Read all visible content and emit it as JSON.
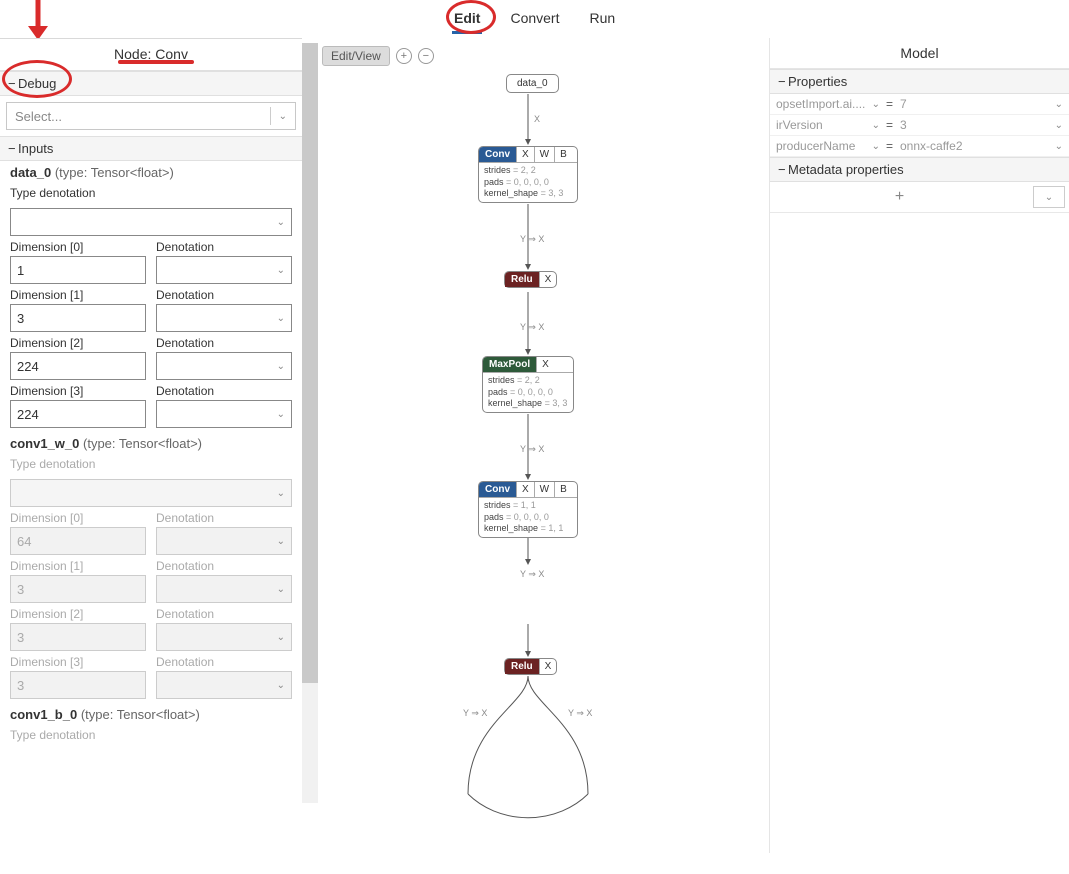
{
  "tabs": {
    "edit": "Edit",
    "convert": "Convert",
    "run": "Run"
  },
  "left": {
    "header": "Node: Conv",
    "debug_section": "Debug",
    "select_placeholder": "Select...",
    "inputs_section": "Inputs",
    "data0": {
      "name": "data_0",
      "type": "(type: Tensor<float>)"
    },
    "type_denotation_label": "Type denotation",
    "dim_label_prefix": "Dimension",
    "denotation_label": "Denotation",
    "data0_dims": [
      "1",
      "3",
      "224",
      "224"
    ],
    "conv1w": {
      "name": "conv1_w_0",
      "type": "(type: Tensor<float>)"
    },
    "conv1w_dims": [
      "64",
      "3",
      "3",
      "3"
    ],
    "conv1b": {
      "name": "conv1_b_0",
      "type": "(type: Tensor<float>)"
    }
  },
  "center": {
    "editview": "Edit/View",
    "input_node": "data_0",
    "edge_x": "X",
    "edge_yx": "Y ⇒ X",
    "conv": {
      "op": "Conv",
      "ports": [
        "X",
        "W",
        "B"
      ],
      "strides": "strides",
      "strides_v": "= 2, 2",
      "pads": "pads",
      "pads_v": "= 0, 0, 0, 0",
      "ks": "kernel_shape",
      "ks_v": "= 3, 3"
    },
    "relu": {
      "op": "Relu",
      "ports": [
        "X"
      ]
    },
    "maxpool": {
      "op": "MaxPool",
      "ports": [
        "X"
      ],
      "strides": "strides",
      "strides_v": "= 2, 2",
      "pads": "pads",
      "pads_v": "= 0, 0, 0, 0",
      "ks": "kernel_shape",
      "ks_v": "= 3, 3"
    },
    "conv2": {
      "op": "Conv",
      "ports": [
        "X",
        "W",
        "B"
      ],
      "strides": "strides",
      "strides_v": "= 1, 1",
      "pads": "pads",
      "pads_v": "= 0, 0, 0, 0",
      "ks": "kernel_shape",
      "ks_v": "= 1, 1"
    }
  },
  "right": {
    "header": "Model",
    "properties_section": "Properties",
    "props": [
      {
        "name": "opsetImport.ai....",
        "val": "7"
      },
      {
        "name": "irVersion",
        "val": "3"
      },
      {
        "name": "producerName",
        "val": "onnx-caffe2"
      }
    ],
    "metadata_section": "Metadata properties"
  }
}
